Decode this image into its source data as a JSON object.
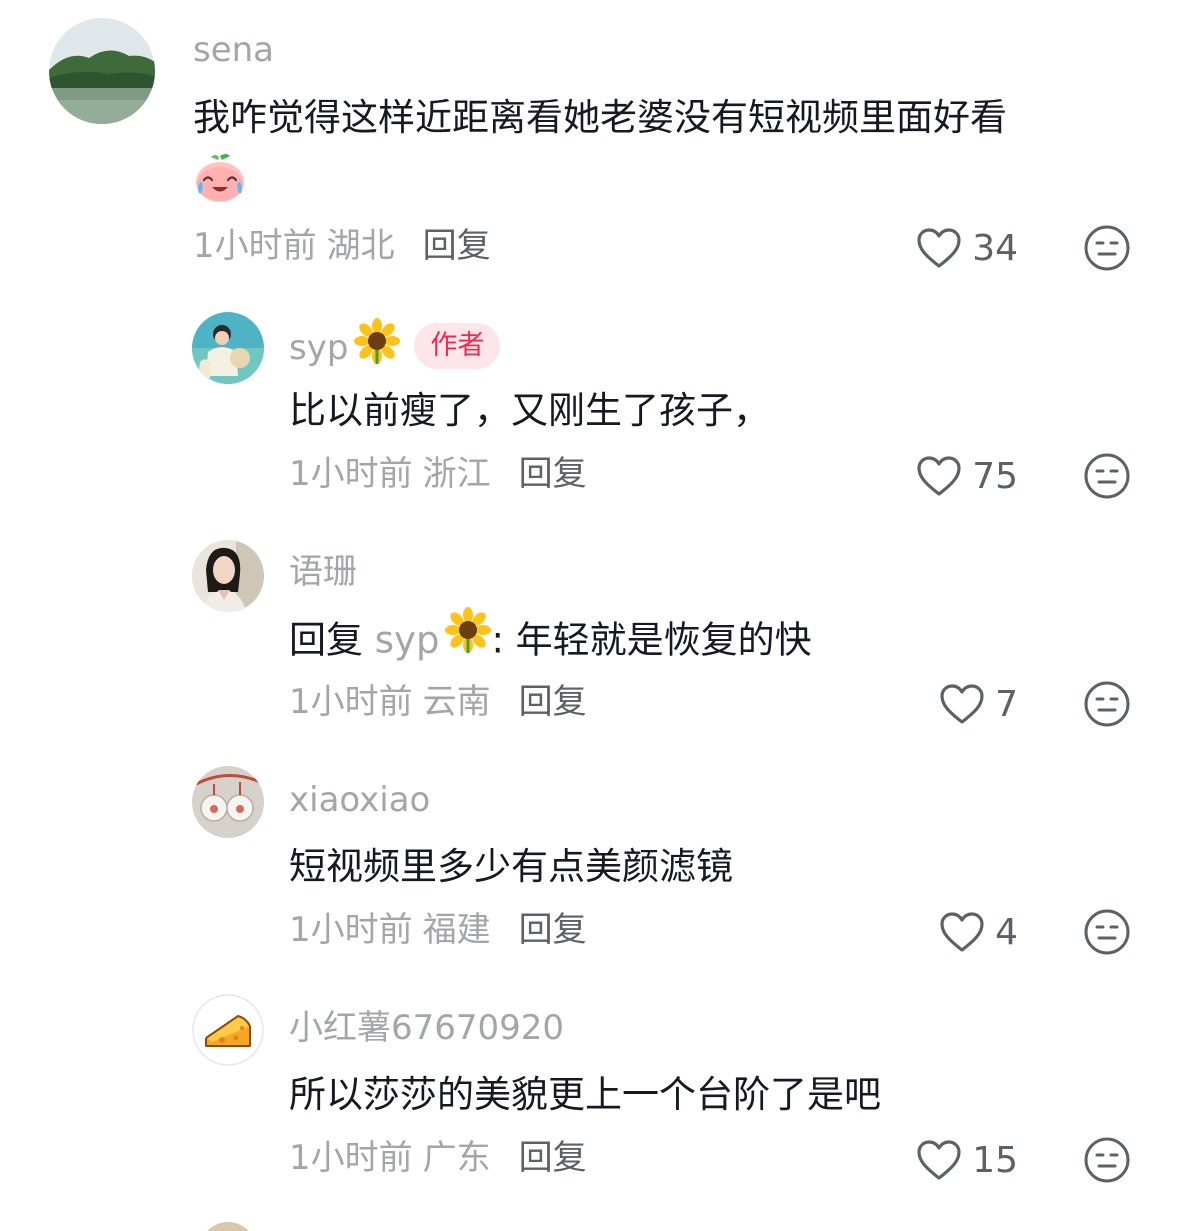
{
  "comments": [
    {
      "username": "sena",
      "text": "我咋觉得这样近距离看她老婆没有短视频里面好看",
      "emoji": "crying-laughing-peach-emoji",
      "time": "1小时前",
      "location": "湖北",
      "reply_label": "回复",
      "likes": "34"
    },
    {
      "username": "syp",
      "author_badge": "作者",
      "text": "比以前瘦了，又刚生了孩子，",
      "time": "1小时前",
      "location": "浙江",
      "reply_label": "回复",
      "likes": "75"
    },
    {
      "username": "语珊",
      "reply_prefix": "回复",
      "reply_target": "syp",
      "text": ": 年轻就是恢复的快",
      "time": "1小时前",
      "location": "云南",
      "reply_label": "回复",
      "likes": "7"
    },
    {
      "username": "xiaoxiao",
      "text": "短视频里多少有点美颜滤镜",
      "time": "1小时前",
      "location": "福建",
      "reply_label": "回复",
      "likes": "4"
    },
    {
      "username": "小红薯67670920",
      "text": "所以莎莎的美貌更上一个台阶了是吧",
      "time": "1小时前",
      "location": "广东",
      "reply_label": "回复",
      "likes": "15"
    }
  ],
  "colors": {
    "text_primary": "#161823",
    "text_secondary": "#a3a5ab",
    "action": "#5e6068",
    "author_badge_bg": "#fde6ea",
    "author_badge_fg": "#f2294b"
  }
}
